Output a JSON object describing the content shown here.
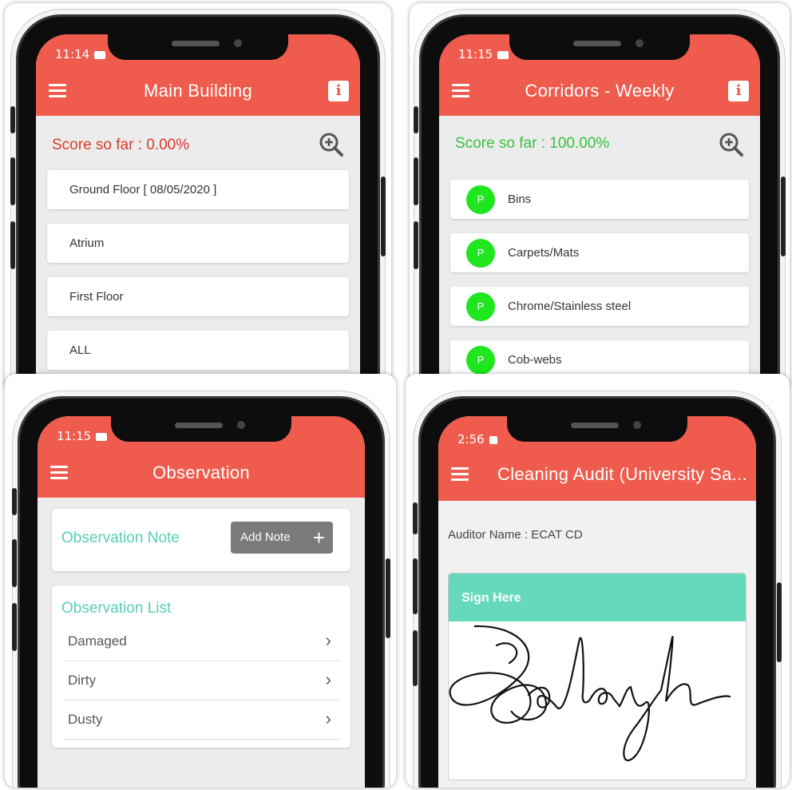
{
  "panels": {
    "main_building": {
      "time": "11:14",
      "title": "Main Building",
      "score_label": "Score so far : 0.00%",
      "score_color": "#d93a2b",
      "items": [
        "Ground Floor [ 08/05/2020 ]",
        "Atrium",
        "First Floor",
        "ALL"
      ]
    },
    "corridors": {
      "time": "11:15",
      "title": "Corridors - Weekly",
      "score_label": "Score so far : 100.00%",
      "score_color": "#36c33a",
      "status_letter": "P",
      "items": [
        "Bins",
        "Carpets/Mats",
        "Chrome/Stainless steel",
        "Cob-webs"
      ]
    },
    "observation": {
      "time": "11:15",
      "title": "Observation",
      "note_heading": "Observation Note",
      "add_note_label": "Add Note",
      "list_heading": "Observation List",
      "items": [
        "Damaged",
        "Dirty",
        "Dusty"
      ]
    },
    "cleaning_audit": {
      "time": "2:56",
      "title": "Cleaning Audit (University Sa...",
      "auditor_label": "Auditor Name : ECAT CD",
      "sign_label": "Sign Here"
    }
  },
  "colors": {
    "appbar": "#ef5b4d",
    "accent_teal": "#55cfb6",
    "pass_green": "#1fe61f"
  },
  "icons": [
    "menu-icon",
    "info-icon",
    "zoom-in-icon",
    "plus-icon",
    "chevron-right-icon"
  ]
}
